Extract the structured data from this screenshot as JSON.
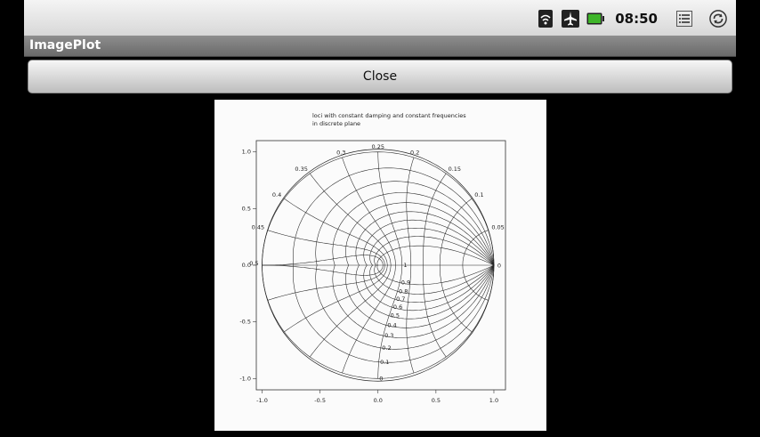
{
  "status_bar": {
    "time": "08:50",
    "icons": [
      "wifi-icon",
      "airplane-mode-icon",
      "battery-icon",
      "notification-list-icon",
      "sync-icon"
    ],
    "battery_color": "#3fb52a"
  },
  "app": {
    "title": "ImagePlot"
  },
  "toolbar": {
    "close_label": "Close"
  },
  "plot": {
    "title_line1": "loci with constant damping and constant frequencies",
    "title_line2": "in discrete plane",
    "x_ticks": [
      "-1.0",
      "-0.5",
      "0.0",
      "0.5",
      "1.0"
    ],
    "y_ticks": [
      "1.0",
      "0.5",
      "0.0",
      "-0.5",
      "-1.0"
    ],
    "damping_labels": [
      "0",
      "0.1",
      "0.2",
      "0.3",
      "0.4",
      "0.5",
      "0.6",
      "0.7",
      "0.8",
      "0.9",
      "1"
    ],
    "frequency_labels": [
      "0",
      "0.05",
      "0.1",
      "0.15",
      "0.2",
      "0.25",
      "0.3",
      "0.35",
      "0.4",
      "0.45",
      "0.5"
    ]
  },
  "chart_data": {
    "type": "line",
    "title": "loci with constant damping and constant frequencies\nin discrete plane",
    "xlim": [
      -1.05,
      1.1
    ],
    "ylim": [
      -1.1,
      1.1
    ],
    "unit_circle": true,
    "damping_ratios": [
      0,
      0.1,
      0.2,
      0.3,
      0.4,
      0.5,
      0.6,
      0.7,
      0.8,
      0.9,
      1
    ],
    "normalized_frequencies": [
      0,
      0.05,
      0.1,
      0.15,
      0.2,
      0.25,
      0.3,
      0.35,
      0.4,
      0.45,
      0.5
    ],
    "grid": false
  }
}
